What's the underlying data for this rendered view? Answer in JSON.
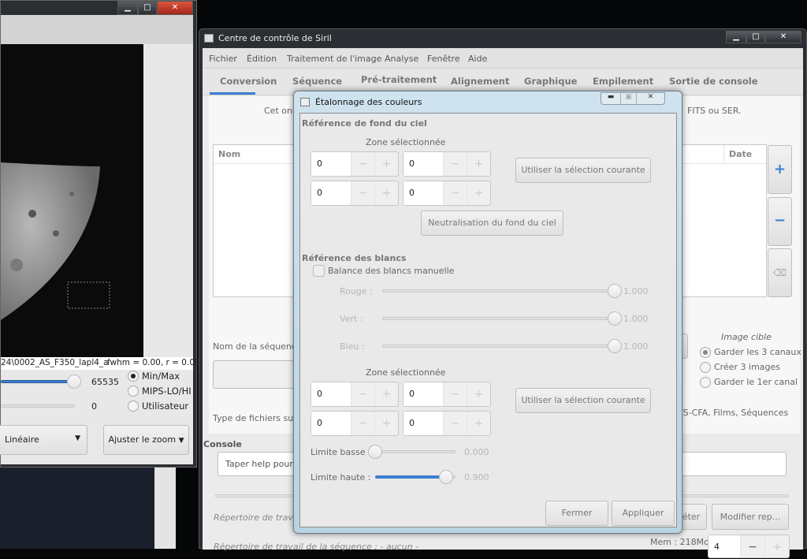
{
  "image_window": {
    "filename": "24\\0002_AS_F350_lapl4_a",
    "fwhm": "fwhm = 0.00, r = 0.00",
    "high_value": "65535",
    "low_value": "0",
    "scale_modes": [
      {
        "label": "Min/Max",
        "selected": true
      },
      {
        "label": "MIPS-LO/HI",
        "selected": false
      },
      {
        "label": "Utilisateur",
        "selected": false
      }
    ],
    "display_mode": "Linéaire",
    "zoom_button": "Ajuster le zoom",
    "slider_high_fraction": 1.0
  },
  "main_window": {
    "title": "Centre de contrôle de Siril",
    "menu": [
      "Fichier",
      "Édition",
      "Traitement de l'image",
      "Analyse",
      "Fenêtre",
      "Aide"
    ],
    "tabs": [
      "Conversion",
      "Séquence",
      "Pré-traitement",
      "Alignement",
      "Graphique",
      "Empilement",
      "Sortie de console"
    ],
    "active_tab": "Conversion",
    "intro_left": "Cet ong",
    "intro_right": "FITS ou SER.",
    "columns": {
      "name": "Nom",
      "date": "Date"
    },
    "sequence_name_label": "Nom de la séquence",
    "target_image": {
      "title": "Image cible",
      "options": [
        {
          "label": "Garder les 3 canaux",
          "selected": true
        },
        {
          "label": "Créer 3 images",
          "selected": false
        },
        {
          "label": "Garder le 1er canal",
          "selected": false
        }
      ]
    },
    "file_types_label": "Type de fichiers supp",
    "file_types_right": "TS-CFA, Films, Séquences",
    "console_label": "Console",
    "console_placeholder": "Taper help pour a",
    "workdir_label": "Répertoire de travail",
    "seq_workdir_label": "Répertoire de travail de la séquence : - aucun -",
    "reset_partial": "éter",
    "modify_button": "Modifier rep...",
    "mem": "Mem : 218Mo",
    "threads": "4",
    "accent": "#3c7fd0"
  },
  "dialog": {
    "title": "Étalonnage des couleurs",
    "bg_section": "Référence de fond du ciel",
    "zone_label": "Zone sélectionnée",
    "bg_values": [
      "0",
      "0",
      "0",
      "0"
    ],
    "use_selection": "Utiliser la sélection courante",
    "neutralize": "Neutralisation du fond du ciel",
    "white_section": "Référence des blancs",
    "manual_wb": "Balance des blancs manuelle",
    "manual_wb_checked": false,
    "channels": [
      {
        "label": "Rouge :",
        "value": "1.000"
      },
      {
        "label": "Vert :",
        "value": "1.000"
      },
      {
        "label": "Bleu :",
        "value": "1.000"
      }
    ],
    "white_values": [
      "0",
      "0",
      "0",
      "0"
    ],
    "low_limit": {
      "label": "Limite basse :",
      "value": "0.000"
    },
    "high_limit": {
      "label": "Limite haute :",
      "value": "0.900"
    },
    "close": "Fermer",
    "apply": "Appliquer"
  }
}
